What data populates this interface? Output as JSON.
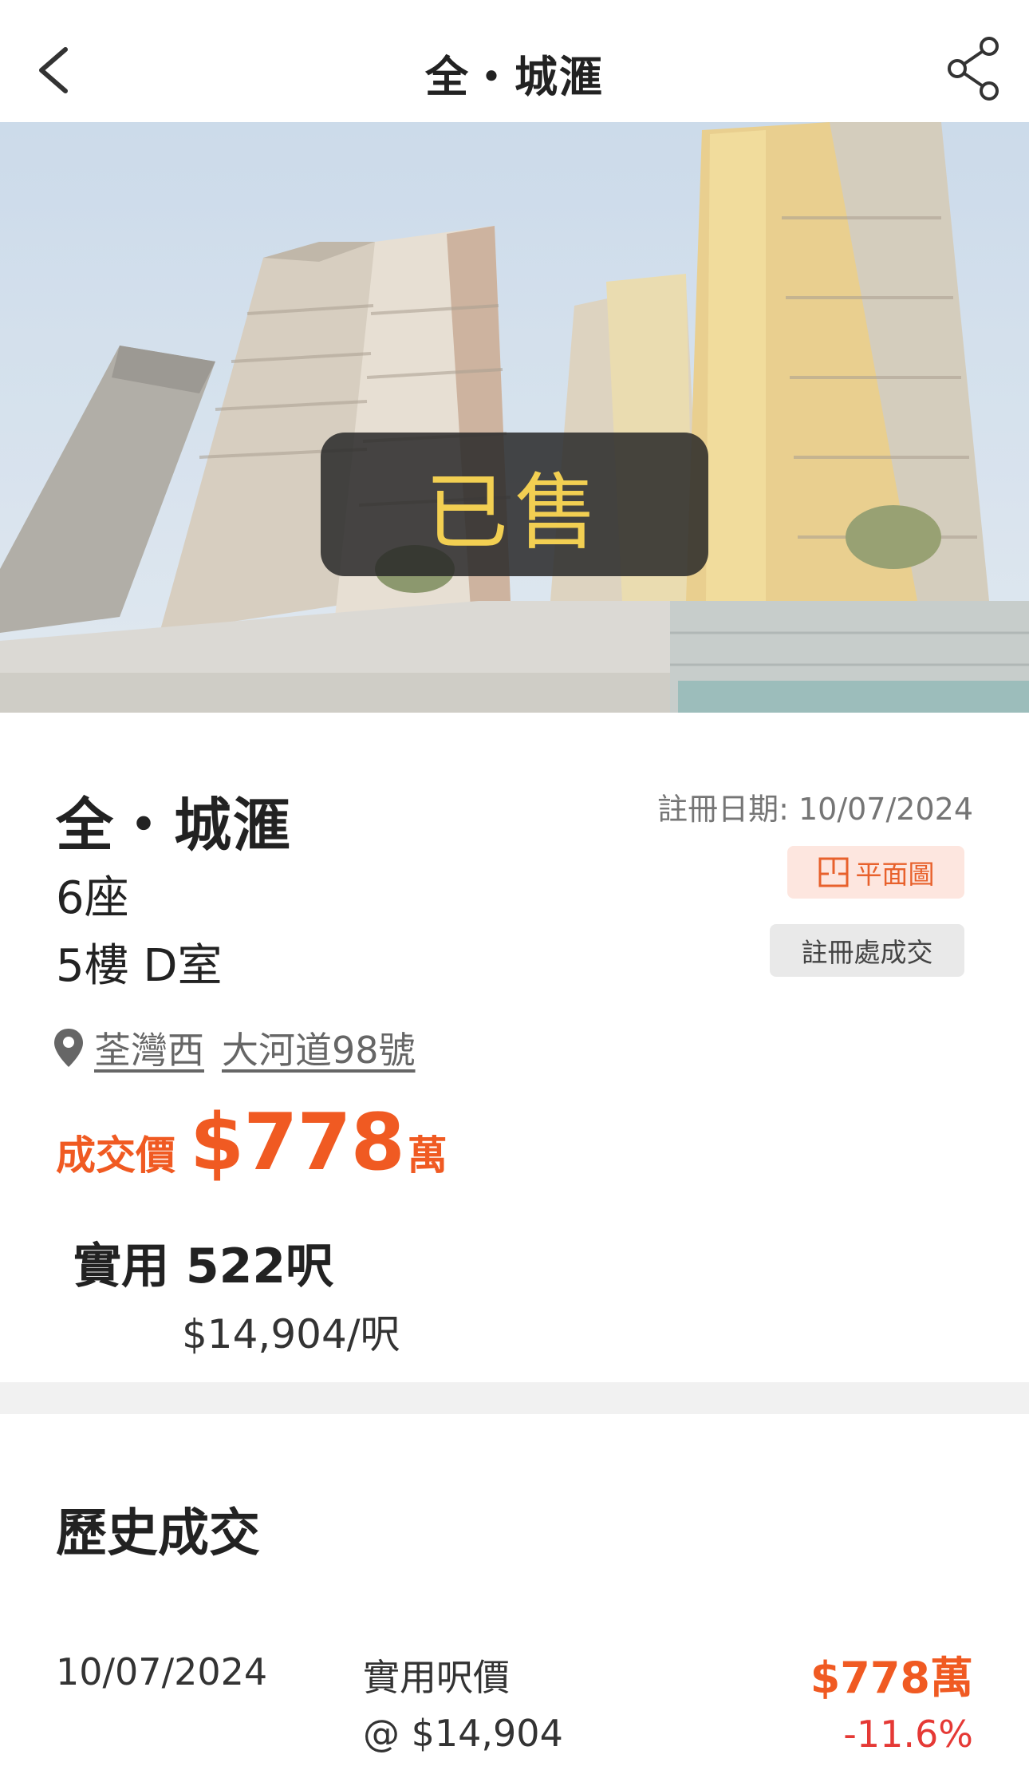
{
  "header": {
    "title": "全・城滙"
  },
  "photo": {
    "sold_label": "已售"
  },
  "details": {
    "project_name": "全・城滙",
    "registration_date": "註冊日期: 10/07/2024",
    "block": "6座",
    "floor_unit": "5樓 D室",
    "floorplan_button": "平面圖",
    "registry_tag": "註冊處成交",
    "district": "荃灣西",
    "address": "大河道98號",
    "price_label": "成交價",
    "price_value": "$778",
    "price_unit": "萬",
    "saleable_area": "實用 522呎",
    "unit_price": "$14,904/呎"
  },
  "history": {
    "title": "歷史成交",
    "records": [
      {
        "date": "10/07/2024",
        "label": "實用呎價",
        "ppsf": "@ $14,904",
        "price": "$778萬",
        "change": "-11.6%"
      }
    ]
  },
  "colors": {
    "accent": "#f05a22",
    "negative": "#e53935",
    "sold_text": "#f2cf52",
    "floorplan_bg": "#fde6df"
  }
}
